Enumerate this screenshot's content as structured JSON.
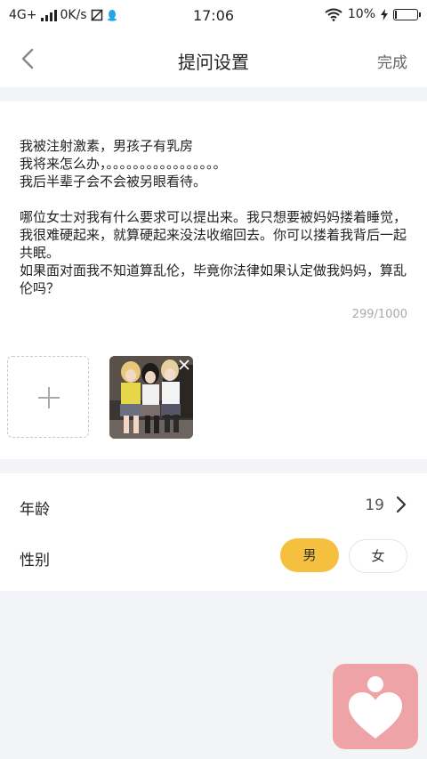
{
  "status_bar": {
    "network": "4G+",
    "speed": "0K/s",
    "time": "17:06",
    "battery_percent": "10%",
    "battery_level": 0.1
  },
  "nav": {
    "title": "提问设置",
    "done_label": "完成"
  },
  "question": {
    "text": "我被注射激素，男孩子有乳房\n我将来怎么办，。。。。。。。。。。。。。。。。。\n我后半辈子会不会被另眼看待。\n\n哪位女士对我有什么要求可以提出来。我只想要被妈妈搂着睡觉，我很难硬起来，就算硬起来没法收缩回去。你可以搂着我背后一起共眠。\n如果面对面我不知道算乱伦，毕竟你法律如果认定做我妈妈，算乱伦吗？",
    "counter": "299/1000"
  },
  "settings": {
    "age_label": "年龄",
    "age_value": "19",
    "gender_label": "性别",
    "gender_options": [
      "男",
      "女"
    ],
    "gender_selected": "男"
  },
  "colors": {
    "accent": "#f5c03d",
    "logo_bg": "#eea3a7"
  }
}
